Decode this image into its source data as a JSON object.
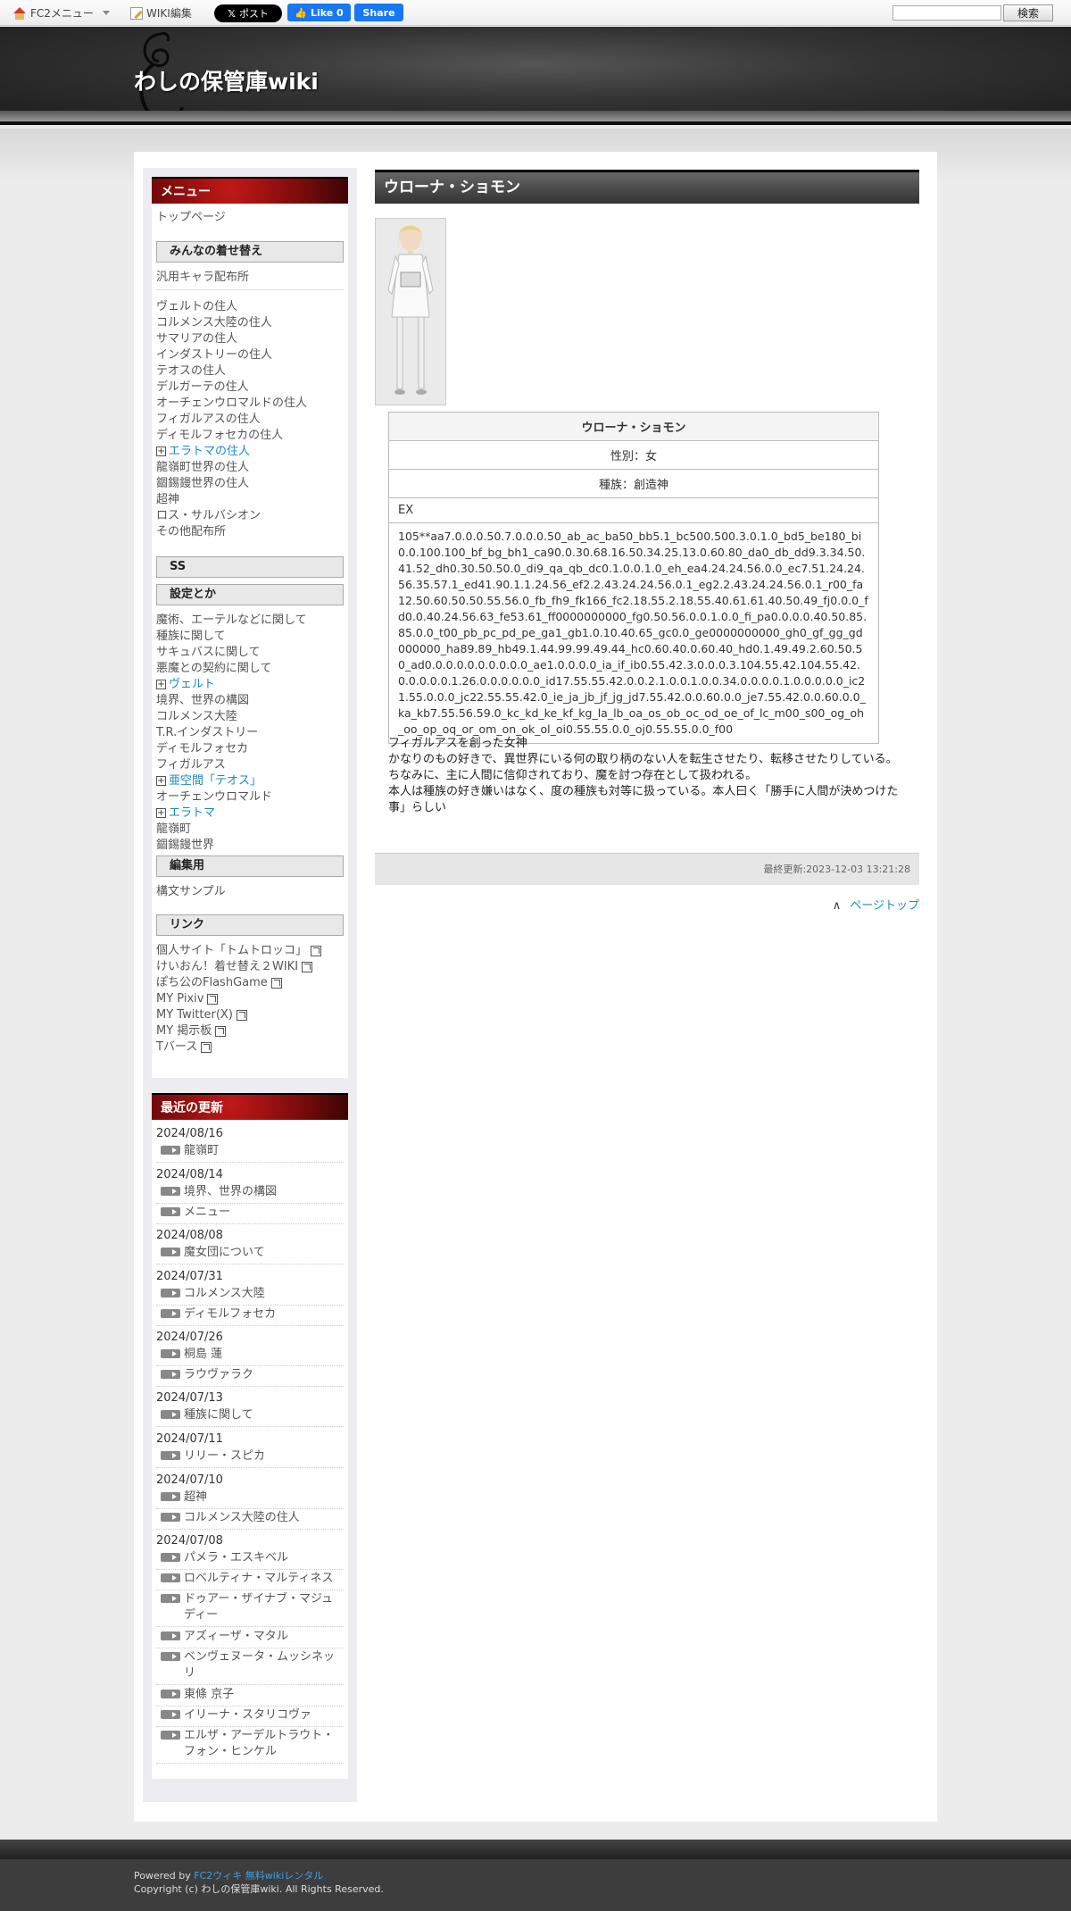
{
  "topbar": {
    "fc2_menu": "FC2メニュー",
    "wiki_edit": "WIKI編集",
    "x_post": "ポスト",
    "fb_like": "Like 0",
    "fb_share": "Share",
    "search_value": "",
    "search_button": "検索"
  },
  "site": {
    "title": "わしの保管庫wiki"
  },
  "menu": {
    "header": "メニュー",
    "top_page": "トップページ",
    "section_kisekae": "みんなの着せ替え",
    "generic_char": "汎用キャラ配布所",
    "kisekae_items": [
      "ヴェルトの住人",
      "コルメンス大陸の住人",
      "サマリアの住人",
      "インダストリーの住人",
      "テオスの住人",
      "デルガーテの住人",
      "オーチェンウロマルドの住人",
      "フィガルアスの住人",
      "ディモルフォセカの住人",
      "エラトマの住人",
      "龍嶺町世界の住人",
      "錮錫鏝世界の住人",
      "超神",
      "ロス・サルバシオン",
      "その他配布所"
    ],
    "section_ss": "SS",
    "section_settings": "設定とか",
    "settings_items": [
      "魔術、エーテルなどに関して",
      "種族に関して",
      "サキュバスに関して",
      "悪魔との契約に関して",
      "ヴェルト",
      "境界、世界の構図",
      "コルメンス大陸",
      "T.R.インダストリー",
      "ディモルフォセカ",
      "フィガルアス",
      "亜空間「テオス」",
      "オーチェンウロマルド",
      "エラトマ",
      "龍嶺町",
      "錮錫鏝世界"
    ],
    "section_edit": "編集用",
    "edit_items": [
      "構文サンプル"
    ],
    "section_links": "リンク",
    "link_items": [
      "個人サイト「トムトロッコ」",
      "けいおん！着せ替え２WIKI",
      "ぽち公のFlashGame",
      "MY Pixiv",
      "MY Twitter(X)",
      "MY 掲示板",
      "Tバース"
    ]
  },
  "recent": {
    "header": "最近の更新",
    "groups": [
      {
        "date": "2024/08/16",
        "items": [
          "龍嶺町"
        ]
      },
      {
        "date": "2024/08/14",
        "items": [
          "境界、世界の構図",
          "メニュー"
        ]
      },
      {
        "date": "2024/08/08",
        "items": [
          "魔女団について"
        ]
      },
      {
        "date": "2024/07/31",
        "items": [
          "コルメンス大陸",
          "ディモルフォセカ"
        ]
      },
      {
        "date": "2024/07/26",
        "items": [
          "桐島 蓮",
          "ラウヴァラク"
        ]
      },
      {
        "date": "2024/07/13",
        "items": [
          "種族に関して"
        ]
      },
      {
        "date": "2024/07/11",
        "items": [
          "リリー・スピカ"
        ]
      },
      {
        "date": "2024/07/10",
        "items": [
          "超神",
          "コルメンス大陸の住人"
        ]
      },
      {
        "date": "2024/07/08",
        "items": [
          "パメラ・エスキベル",
          "ロベルティナ・マルティネス",
          "ドゥアー・ザイナブ・マジュディー",
          "アズィーザ・マタル",
          "ベンヴェヌータ・ムッシネッリ",
          "東條 京子",
          "イリーナ・スタリコヴァ",
          "エルザ・アーデルトラウト・フォン・ヒンケル"
        ]
      }
    ]
  },
  "page": {
    "title": "ウローナ・ショモン",
    "table": {
      "name": "ウローナ・ショモン",
      "gender": "性別：女",
      "race": "種族：創造神",
      "ex": "EX",
      "code": "105**aa7.0.0.0.50.7.0.0.0.50_ab_ac_ba50_bb5.1_bc500.500.3.0.1.0_bd5_be180_bi0.0.100.100_bf_bg_bh1_ca90.0.30.68.16.50.34.25.13.0.60.80_da0_db_dd9.3.34.50.41.52_dh0.30.50.50.0_di9_qa_qb_dc0.1.0.0.1.0_eh_ea4.24.24.56.0.0_ec7.51.24.24.56.35.57.1_ed41.90.1.1.24.56_ef2.2.43.24.24.56.0.1_eg2.2.43.24.24.56.0.1_r00_fa12.50.60.50.50.55.56.0_fb_fh9_fk166_fc2.18.55.2.18.55.40.61.61.40.50.49_fj0.0.0_fd0.0.40.24.56.63_fe53.61_ff0000000000_fg0.50.56.0.0.1.0.0_fi_pa0.0.0.0.40.50.85.85.0.0_t00_pb_pc_pd_pe_ga1_gb1.0.10.40.65_gc0.0_ge0000000000_gh0_gf_gg_gd000000_ha89.89_hb49.1.44.99.99.49.44_hc0.60.40.0.60.40_hd0.1.49.49.2.60.50.50_ad0.0.0.0.0.0.0.0.0.0_ae1.0.0.0.0_ia_if_ib0.55.42.3.0.0.0.3.104.55.42.104.55.42.0.0.0.0.0.1.26.0.0.0.0.0.0_id17.55.55.42.0.0.2.1.0.0.1.0.0.34.0.0.0.0.1.0.0.0.0.0_ic21.55.0.0.0_jc22.55.55.42.0_ie_ja_jb_jf_jg_jd7.55.42.0.0.60.0.0_je7.55.42.0.0.60.0.0_ka_kb7.55.56.59.0_kc_kd_ke_kf_kg_la_lb_oa_os_ob_oc_od_oe_of_lc_m00_s00_og_oh_oo_op_oq_or_om_on_ok_ol_oi0.55.55.0.0_oj0.55.55.0.0_f00"
    },
    "description": [
      "フィガルアスを創った女神",
      "かなりのもの好きで、異世界にいる何の取り柄のない人を転生させたり、転移させたりしている。",
      "ちなみに、主に人間に信仰されており、魔を討つ存在として扱われる。",
      "本人は種族の好き嫌いはなく、度の種族も対等に扱っている。本人曰く「勝手に人間が決めつけた事」らしい"
    ],
    "last_updated": "最終更新:2023-12-03 13:21:28",
    "page_top": "ページトップ"
  },
  "footer": {
    "powered_prefix": "Powered by ",
    "powered_link": "FC2ウィキ 無料wikiレンタル",
    "copyright": "Copyright (c) わしの保管庫wiki. All Rights Reserved."
  }
}
